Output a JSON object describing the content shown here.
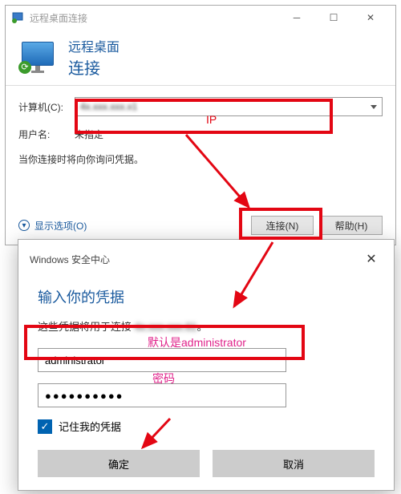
{
  "main_window": {
    "title": "远程桌面连接",
    "header_line1": "远程桌面",
    "header_line2": "连接",
    "computer_label": "计算机(C):",
    "computer_value": "4x.xxx.xxx.x1",
    "username_label": "用户名:",
    "username_value": "未指定",
    "hint": "当你连接时将向你询问凭据。",
    "show_options": "显示选项(O)",
    "connect_btn": "连接(N)",
    "help_btn": "帮助(H)"
  },
  "dialog": {
    "titlebar": "Windows 安全中心",
    "heading": "输入你的凭据",
    "desc_prefix": "这些凭据将用于连接 ",
    "desc_ip": "4x.xxx.xxx.61",
    "desc_suffix": "。",
    "username_value": "administrator",
    "password_value": "●●●●●●●●●●",
    "remember_label": "记住我的凭据",
    "ok_btn": "确定",
    "cancel_btn": "取消"
  },
  "annotations": {
    "ip_label": "IP",
    "default_admin": "默认是administrator",
    "password_label": "密码"
  }
}
